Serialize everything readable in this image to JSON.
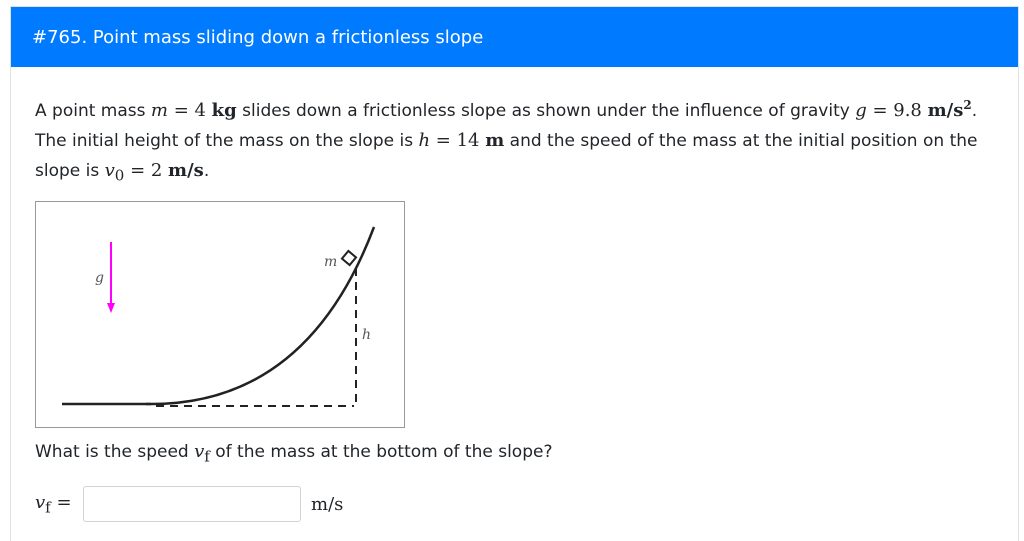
{
  "header": {
    "title": "#765. Point mass sliding down a frictionless slope"
  },
  "problem": {
    "t1": "A point mass ",
    "m_sym": "m",
    "m_val": " = 4 ",
    "m_unit": "kg",
    "t2": " slides down a frictionless slope as shown under the influence of gravity ",
    "g_sym": "g",
    "g_val": " = 9.8 ",
    "g_unit": "m/s",
    "g_exp": "2",
    "t3": ". The initial height of the mass on the slope is ",
    "h_sym": "h",
    "h_val": " = 14 ",
    "h_unit": "m",
    "t4": " and the speed of the mass at the initial position on the slope is ",
    "v0_sym": "v",
    "v0_sub": "0",
    "v0_val": " = 2 ",
    "v0_unit": "m/s",
    "t5": "."
  },
  "figure": {
    "g_label": "g",
    "m_label": "m",
    "h_label": "h",
    "arrow_color": "#ff00ff"
  },
  "question": {
    "t1": "What is the speed ",
    "v_sym": "v",
    "v_sub": "f",
    "t2": " of the mass at the bottom of the slope?"
  },
  "answer": {
    "var": "v",
    "var_sub": "f",
    "eq": " =",
    "input_value": "",
    "unit": "m/s"
  }
}
